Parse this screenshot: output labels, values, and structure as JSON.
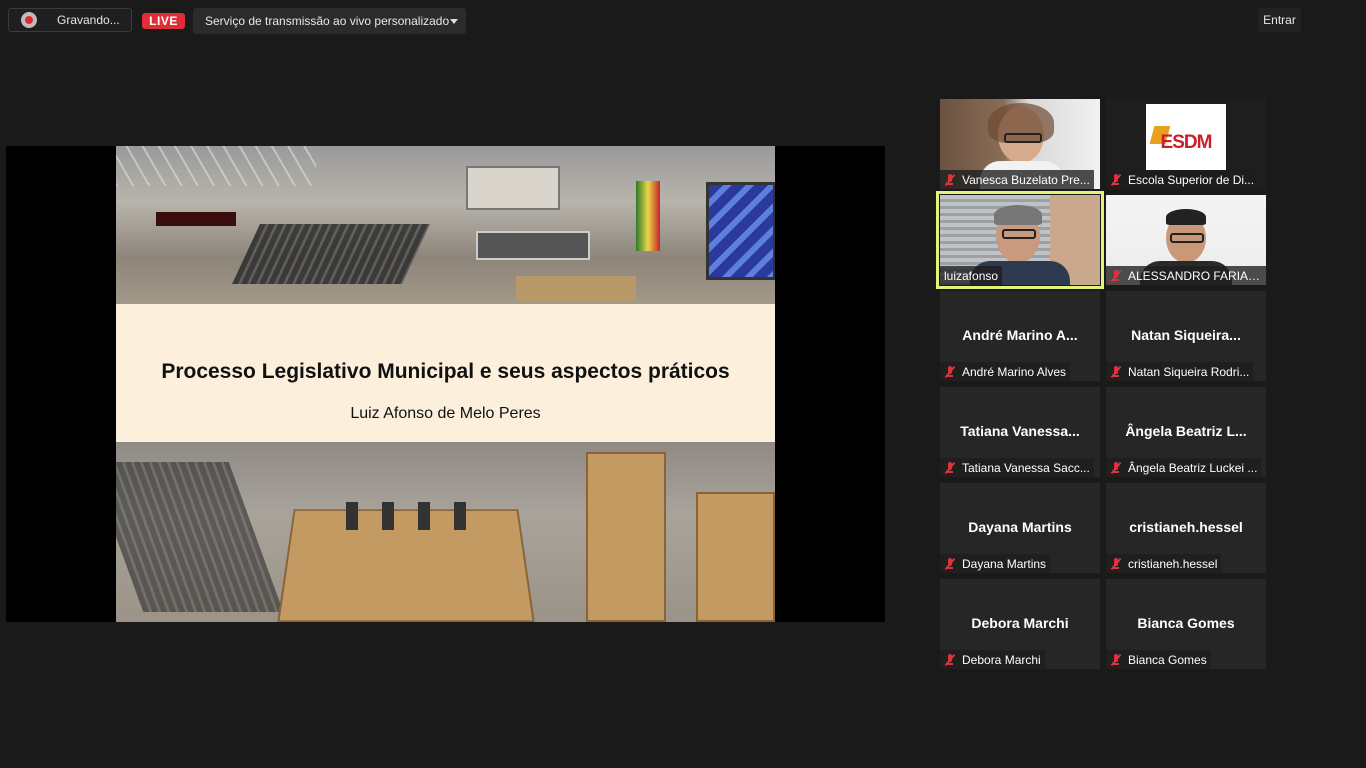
{
  "topbar": {
    "recording_label": "Gravando...",
    "live_badge": "LIVE",
    "stream_service": "Serviço de transmissão ao vivo personalizado",
    "enter_button": "Entrar"
  },
  "slide": {
    "title": "Processo Legislativo Municipal e seus aspectos práticos",
    "subtitle": "Luiz Afonso de Melo Peres"
  },
  "participants": [
    {
      "label": "Vanesca Buzelato Pre...",
      "center": "",
      "muted": true,
      "video": true
    },
    {
      "label": "Escola Superior de Di...",
      "center": "",
      "muted": true,
      "video": true,
      "logo": "ESDM"
    },
    {
      "label": "luizafonso",
      "center": "",
      "muted": false,
      "video": true,
      "active": true
    },
    {
      "label": "ALESSANDRO FARIAS...",
      "center": "",
      "muted": true,
      "video": true
    },
    {
      "label": "André Marino Alves",
      "center": "André Marino A...",
      "muted": true,
      "video": false
    },
    {
      "label": "Natan Siqueira Rodri...",
      "center": "Natan  Siqueira...",
      "muted": true,
      "video": false
    },
    {
      "label": "Tatiana Vanessa Sacc...",
      "center": "Tatiana  Vanessa...",
      "muted": true,
      "video": false
    },
    {
      "label": "Ângela Beatriz Luckei ...",
      "center": "Ângela Beatriz L...",
      "muted": true,
      "video": false
    },
    {
      "label": "Dayana Martins",
      "center": "Dayana Martins",
      "muted": true,
      "video": false
    },
    {
      "label": "cristianeh.hessel",
      "center": "cristianeh.hessel",
      "muted": true,
      "video": false
    },
    {
      "label": "Debora Marchi",
      "center": "Debora Marchi",
      "muted": true,
      "video": false
    },
    {
      "label": "Bianca Gomes",
      "center": "Bianca Gomes",
      "muted": true,
      "video": false
    }
  ],
  "colors": {
    "background": "#1a1a1a",
    "live_red": "#e02d38",
    "mute_red": "#e0323b",
    "active_speaker": "#e3f27a",
    "slide_band": "#fcf0dc"
  },
  "icons": {
    "recording": "recording-icon",
    "muted": "mic-muted-icon",
    "dropdown": "chevron-down-icon"
  }
}
